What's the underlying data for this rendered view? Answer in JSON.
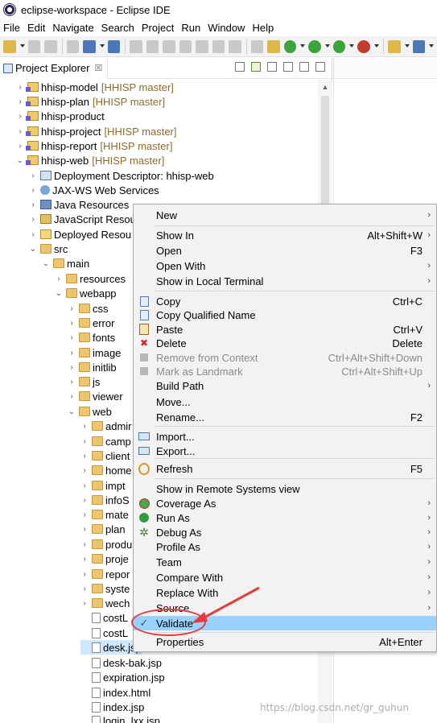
{
  "window": {
    "title": "eclipse-workspace - Eclipse IDE"
  },
  "menubar": {
    "items": [
      "File",
      "Edit",
      "Navigate",
      "Search",
      "Project",
      "Run",
      "Window",
      "Help"
    ]
  },
  "explorer": {
    "tab_label": "Project Explorer",
    "tab_close_symbol": "☒",
    "tree": [
      {
        "label": "hhisp-model",
        "repo": "[HHISP master]",
        "icon": "project-icon",
        "twisty": ">"
      },
      {
        "label": "hhisp-plan",
        "repo": "[HHISP master]",
        "icon": "project-icon",
        "twisty": ">"
      },
      {
        "label": "hhisp-product",
        "repo": "",
        "icon": "project-icon",
        "twisty": ">"
      },
      {
        "label": "hhisp-project",
        "repo": "[HHISP master]",
        "icon": "project-icon",
        "twisty": ">"
      },
      {
        "label": "hhisp-report",
        "repo": "[HHISP master]",
        "icon": "project-icon",
        "twisty": ">"
      },
      {
        "label": "hhisp-web",
        "repo": "[HHISP master]",
        "icon": "project-icon",
        "twisty": "v"
      },
      {
        "label": "Deployment Descriptor: hhisp-web",
        "repo": "",
        "icon": "descriptor-icon",
        "twisty": ">"
      },
      {
        "label": "JAX-WS Web Services",
        "repo": "",
        "icon": "jaxws-icon",
        "twisty": ">"
      },
      {
        "label": "Java Resources",
        "repo": "",
        "icon": "java-resources-icon",
        "twisty": ">"
      },
      {
        "label": "JavaScript Resou",
        "repo": "",
        "icon": "javascript-resources-icon",
        "twisty": ">"
      },
      {
        "label": "Deployed Resou",
        "repo": "",
        "icon": "deployed-resources-icon",
        "twisty": ">"
      },
      {
        "label": "src",
        "repo": "",
        "icon": "folder-icon",
        "twisty": "v"
      },
      {
        "label": "main",
        "repo": "",
        "icon": "folder-icon",
        "twisty": "v"
      },
      {
        "label": "resources",
        "repo": "",
        "icon": "folder-icon",
        "twisty": ">"
      },
      {
        "label": "webapp",
        "repo": "",
        "icon": "folder-icon",
        "twisty": "v"
      },
      {
        "label": "css",
        "repo": "",
        "icon": "folder-icon",
        "twisty": ">"
      },
      {
        "label": "error",
        "repo": "",
        "icon": "folder-icon",
        "twisty": ">"
      },
      {
        "label": "fonts",
        "repo": "",
        "icon": "folder-icon",
        "twisty": ">"
      },
      {
        "label": "image",
        "repo": "",
        "icon": "folder-icon",
        "twisty": ">"
      },
      {
        "label": "initlib",
        "repo": "",
        "icon": "folder-icon",
        "twisty": ">"
      },
      {
        "label": "js",
        "repo": "",
        "icon": "folder-icon",
        "twisty": ">"
      },
      {
        "label": "viewer",
        "repo": "",
        "icon": "folder-icon",
        "twisty": ">"
      },
      {
        "label": "web",
        "repo": "",
        "icon": "folder-icon",
        "twisty": "v"
      },
      {
        "label": "admir",
        "repo": "",
        "icon": "folder-icon",
        "twisty": ">"
      },
      {
        "label": "camp",
        "repo": "",
        "icon": "folder-icon",
        "twisty": ">"
      },
      {
        "label": "client",
        "repo": "",
        "icon": "folder-icon",
        "twisty": ">"
      },
      {
        "label": "home",
        "repo": "",
        "icon": "folder-icon",
        "twisty": ">"
      },
      {
        "label": "impt",
        "repo": "",
        "icon": "folder-icon",
        "twisty": ">"
      },
      {
        "label": "infoS",
        "repo": "",
        "icon": "folder-icon",
        "twisty": ">"
      },
      {
        "label": "mate",
        "repo": "",
        "icon": "folder-icon",
        "twisty": ">"
      },
      {
        "label": "plan",
        "repo": "",
        "icon": "folder-icon",
        "twisty": ">"
      },
      {
        "label": "produ",
        "repo": "",
        "icon": "folder-icon",
        "twisty": ">"
      },
      {
        "label": "proje",
        "repo": "",
        "icon": "folder-icon",
        "twisty": ">"
      },
      {
        "label": "repor",
        "repo": "",
        "icon": "folder-icon",
        "twisty": ">"
      },
      {
        "label": "syste",
        "repo": "",
        "icon": "folder-icon",
        "twisty": ">"
      },
      {
        "label": "wech",
        "repo": "",
        "icon": "folder-icon",
        "twisty": ">"
      },
      {
        "label": "costL",
        "repo": "",
        "icon": "file-icon",
        "twisty": ""
      },
      {
        "label": "costL",
        "repo": "",
        "icon": "file-icon",
        "twisty": ""
      },
      {
        "label": "desk.jsp",
        "repo": "",
        "icon": "file-icon",
        "twisty": "",
        "selected": true
      },
      {
        "label": "desk-bak.jsp",
        "repo": "",
        "icon": "file-icon",
        "twisty": ""
      },
      {
        "label": "expiration.jsp",
        "repo": "",
        "icon": "file-icon",
        "twisty": ""
      },
      {
        "label": "index.html",
        "repo": "",
        "icon": "file-icon",
        "twisty": ""
      },
      {
        "label": "index.jsp",
        "repo": "",
        "icon": "file-icon",
        "twisty": ""
      },
      {
        "label": "login_lxx.jsp",
        "repo": "",
        "icon": "file-icon",
        "twisty": ""
      }
    ]
  },
  "context_menu": {
    "items": [
      {
        "label": "New",
        "shortcut": "",
        "submenu": true,
        "icon": ""
      },
      {
        "sep": true
      },
      {
        "label": "Show In",
        "shortcut": "Alt+Shift+W",
        "submenu": true,
        "icon": ""
      },
      {
        "label": "Open",
        "shortcut": "F3",
        "submenu": false,
        "icon": ""
      },
      {
        "label": "Open With",
        "shortcut": "",
        "submenu": true,
        "icon": ""
      },
      {
        "label": "Show in Local Terminal",
        "shortcut": "",
        "submenu": true,
        "icon": ""
      },
      {
        "sep": true
      },
      {
        "label": "Copy",
        "shortcut": "Ctrl+C",
        "submenu": false,
        "icon": "copy-icon"
      },
      {
        "label": "Copy Qualified Name",
        "shortcut": "",
        "submenu": false,
        "icon": "copy-icon"
      },
      {
        "label": "Paste",
        "shortcut": "Ctrl+V",
        "submenu": false,
        "icon": "paste-icon"
      },
      {
        "label": "Delete",
        "shortcut": "Delete",
        "submenu": false,
        "icon": "delete-icon"
      },
      {
        "label": "Remove from Context",
        "shortcut": "Ctrl+Alt+Shift+Down",
        "submenu": false,
        "icon": "remove-context-icon",
        "disabled": true
      },
      {
        "label": "Mark as Landmark",
        "shortcut": "Ctrl+Alt+Shift+Up",
        "submenu": false,
        "icon": "landmark-icon",
        "disabled": true
      },
      {
        "label": "Build Path",
        "shortcut": "",
        "submenu": true,
        "icon": ""
      },
      {
        "label": "Move...",
        "shortcut": "",
        "submenu": false,
        "icon": ""
      },
      {
        "label": "Rename...",
        "shortcut": "F2",
        "submenu": false,
        "icon": ""
      },
      {
        "sep": true
      },
      {
        "label": "Import...",
        "shortcut": "",
        "submenu": false,
        "icon": "import-icon"
      },
      {
        "label": "Export...",
        "shortcut": "",
        "submenu": false,
        "icon": "export-icon"
      },
      {
        "sep": true
      },
      {
        "label": "Refresh",
        "shortcut": "F5",
        "submenu": false,
        "icon": "refresh-icon"
      },
      {
        "sep": true
      },
      {
        "label": "Show in Remote Systems view",
        "shortcut": "",
        "submenu": false,
        "icon": ""
      },
      {
        "label": "Coverage As",
        "shortcut": "",
        "submenu": true,
        "icon": "coverage-icon"
      },
      {
        "label": "Run As",
        "shortcut": "",
        "submenu": true,
        "icon": "run-icon"
      },
      {
        "label": "Debug As",
        "shortcut": "",
        "submenu": true,
        "icon": "debug-icon"
      },
      {
        "label": "Profile As",
        "shortcut": "",
        "submenu": true,
        "icon": ""
      },
      {
        "label": "Team",
        "shortcut": "",
        "submenu": true,
        "icon": ""
      },
      {
        "label": "Compare With",
        "shortcut": "",
        "submenu": true,
        "icon": ""
      },
      {
        "label": "Replace With",
        "shortcut": "",
        "submenu": true,
        "icon": ""
      },
      {
        "label": "Source",
        "shortcut": "",
        "submenu": true,
        "icon": ""
      },
      {
        "label": "Validate",
        "shortcut": "",
        "submenu": false,
        "icon": "check-icon",
        "highlighted": true
      },
      {
        "sep": true
      },
      {
        "label": "Properties",
        "shortcut": "Alt+Enter",
        "submenu": false,
        "icon": ""
      }
    ]
  },
  "colors": {
    "menu_highlight": "#99d1ff",
    "annotation": "#e53b3b",
    "repo_text": "#8b6b2d",
    "selection": "#cde8ff"
  },
  "watermark": "https://blog.csdn.net/gr_guhun"
}
